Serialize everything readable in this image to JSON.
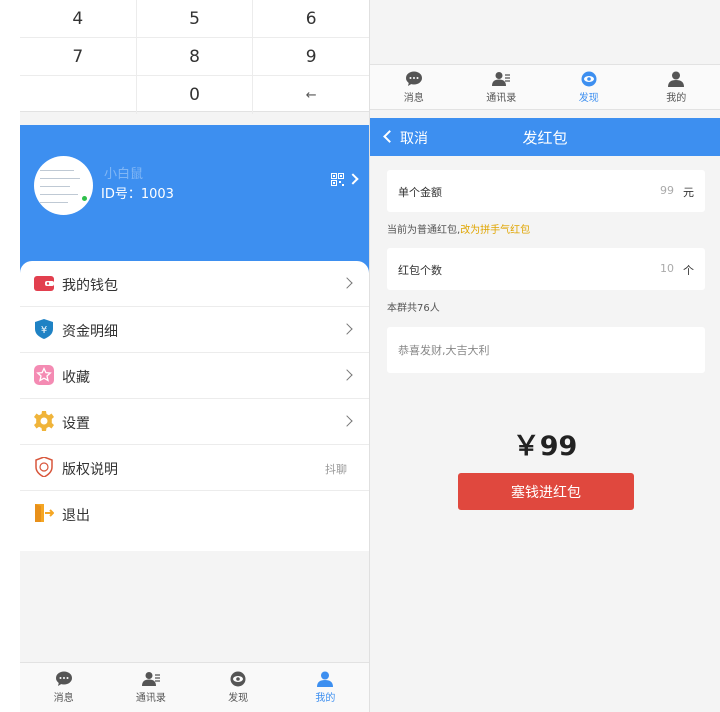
{
  "keypad": {
    "rows": [
      [
        "4",
        "5",
        "6"
      ],
      [
        "7",
        "8",
        "9"
      ],
      [
        "",
        "0",
        "←"
      ]
    ]
  },
  "profile": {
    "nickname": "小白鼠",
    "id_text": "ID号：1003"
  },
  "menu": [
    {
      "label": "我的钱包",
      "icon": "wallet-icon",
      "chevron": true,
      "extra": ""
    },
    {
      "label": "资金明细",
      "icon": "yen-shield-icon",
      "chevron": true,
      "extra": ""
    },
    {
      "label": "收藏",
      "icon": "star-icon",
      "chevron": true,
      "extra": ""
    },
    {
      "label": "设置",
      "icon": "gear-icon",
      "chevron": true,
      "extra": ""
    },
    {
      "label": "版权说明",
      "icon": "copyright-icon",
      "chevron": false,
      "extra": "抖聊"
    },
    {
      "label": "退出",
      "icon": "exit-icon",
      "chevron": false,
      "extra": ""
    }
  ],
  "tabs": [
    {
      "label": "消息",
      "icon": "chat-icon"
    },
    {
      "label": "通讯录",
      "icon": "contacts-icon"
    },
    {
      "label": "发现",
      "icon": "eye-icon"
    },
    {
      "label": "我的",
      "icon": "person-icon"
    }
  ],
  "left_active_tab": "我的",
  "right_active_tab": "发现",
  "redpacket": {
    "cancel": "取消",
    "title": "发红包",
    "amount_label": "单个金额",
    "amount_value": "99",
    "amount_unit": "元",
    "hint_prefix": "当前为普通红包,",
    "hint_link": "改为拼手气红包",
    "count_label": "红包个数",
    "count_value": "10",
    "count_unit": "个",
    "group_info": "本群共76人",
    "greeting": "恭喜发财,大吉大利",
    "total": "￥99",
    "send_button": "塞钱进红包"
  },
  "colors": {
    "primary": "#3d8ff0",
    "send_button": "#e0483e",
    "link": "#e0a500"
  }
}
